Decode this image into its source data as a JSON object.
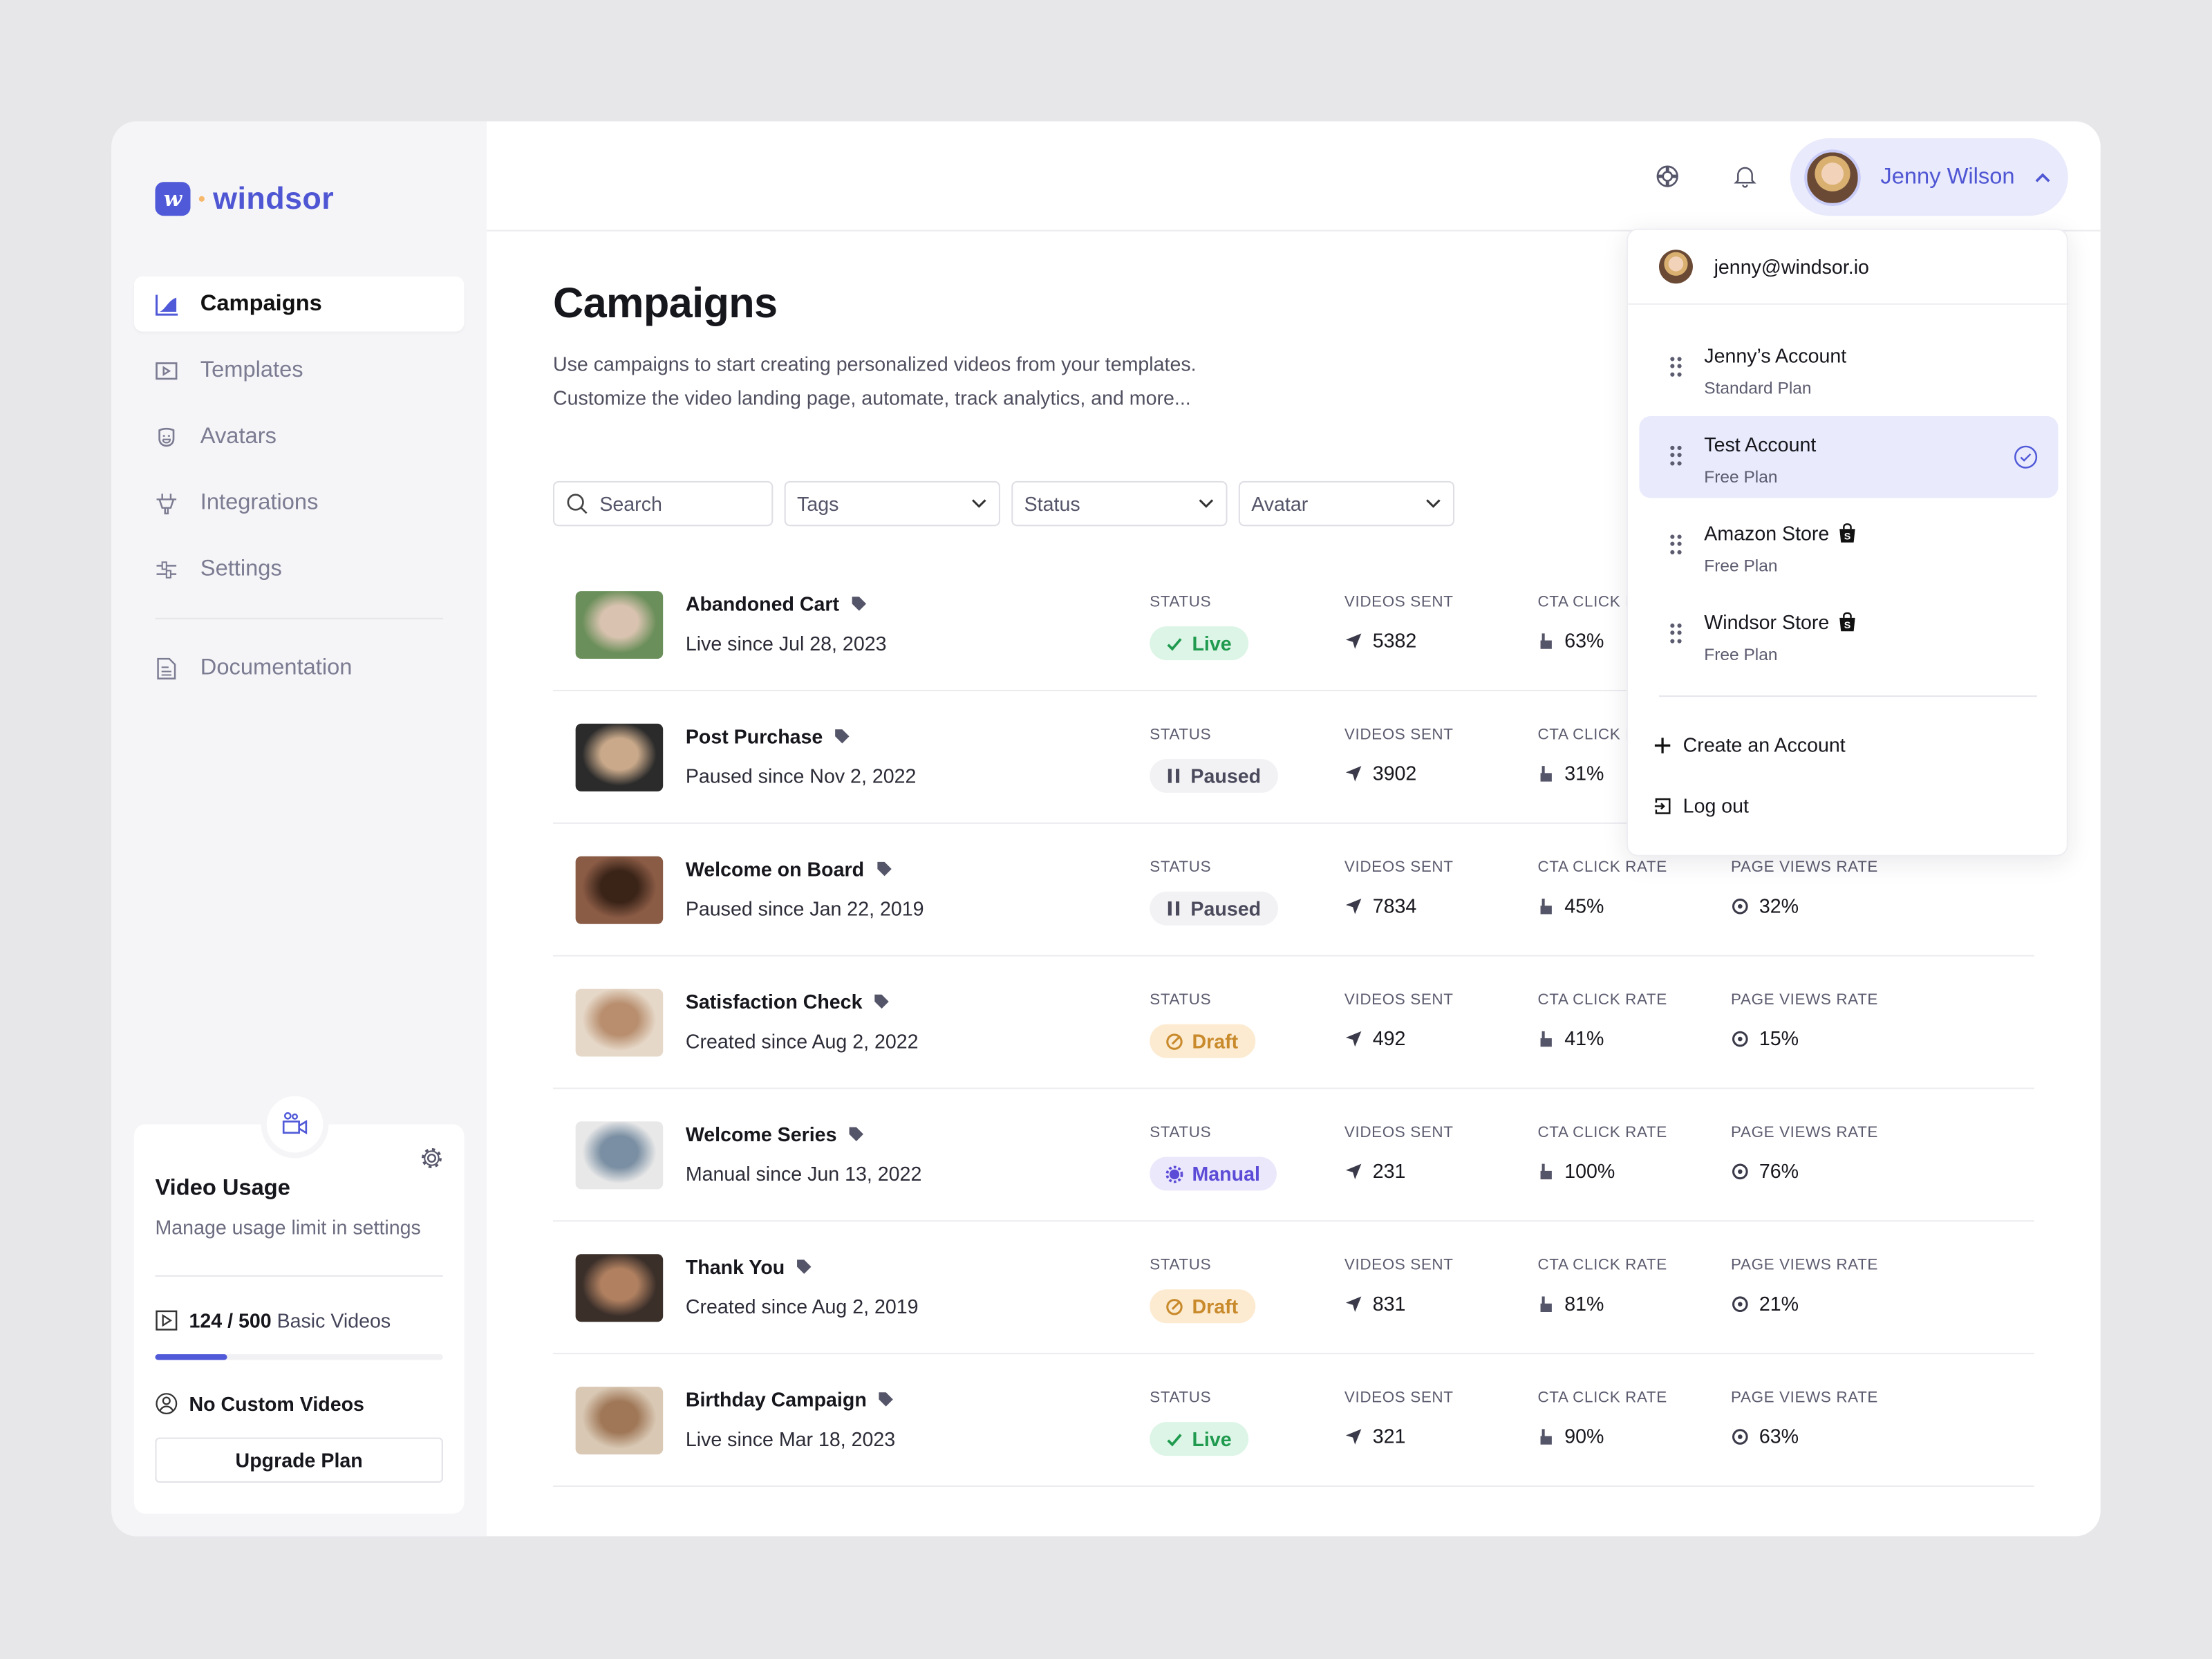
{
  "brand": {
    "name": "windsor",
    "mark": "w",
    "accent": "#5059d8"
  },
  "sidebar": {
    "items": [
      {
        "label": "Campaigns",
        "icon": "chart-area-icon",
        "active": true
      },
      {
        "label": "Templates",
        "icon": "play-box-icon"
      },
      {
        "label": "Avatars",
        "icon": "mask-icon"
      },
      {
        "label": "Integrations",
        "icon": "plug-icon"
      },
      {
        "label": "Settings",
        "icon": "sliders-icon"
      },
      {
        "label": "Documentation",
        "icon": "document-icon"
      }
    ]
  },
  "usage": {
    "title": "Video Usage",
    "subtitle": "Manage usage limit in settings",
    "basic_count": "124 / 500",
    "basic_label": "Basic Videos",
    "basic_fraction": 0.248,
    "custom": "No Custom Videos",
    "upgrade": "Upgrade Plan"
  },
  "header": {
    "user_name": "Jenny Wilson"
  },
  "main": {
    "title": "Campaigns",
    "desc1": "Use campaigns to start creating personalized videos from your templates.",
    "desc2": "Customize the video landing page, automate, track analytics, and more...",
    "filters": {
      "search_placeholder": "Search",
      "tags": "Tags",
      "status": "Status",
      "avatar": "Avatar"
    },
    "labels": {
      "status": "STATUS",
      "videos": "VIDEOS SENT",
      "cta": "CTA CLICK RATE",
      "pv": "PAGE VIEWS RATE"
    }
  },
  "campaigns": [
    {
      "title": "Abandoned Cart",
      "sub": "Live since Jul 28, 2023",
      "status": "Live",
      "videos": "5382",
      "cta": "63%",
      "pv": ""
    },
    {
      "title": "Post Purchase",
      "sub": "Paused since Nov 2, 2022",
      "status": "Paused",
      "videos": "3902",
      "cta": "31%",
      "pv": ""
    },
    {
      "title": "Welcome on Board",
      "sub": "Paused since Jan 22, 2019",
      "status": "Paused",
      "videos": "7834",
      "cta": "45%",
      "pv": "32%"
    },
    {
      "title": "Satisfaction Check",
      "sub": "Created since Aug 2, 2022",
      "status": "Draft",
      "videos": "492",
      "cta": "41%",
      "pv": "15%"
    },
    {
      "title": "Welcome Series",
      "sub": "Manual since Jun 13, 2022",
      "status": "Manual",
      "videos": "231",
      "cta": "100%",
      "pv": "76%"
    },
    {
      "title": "Thank You",
      "sub": "Created since Aug 2, 2019",
      "status": "Draft",
      "videos": "831",
      "cta": "81%",
      "pv": "21%"
    },
    {
      "title": "Birthday Campaign",
      "sub": "Live since Mar 18, 2023",
      "status": "Live",
      "videos": "321",
      "cta": "90%",
      "pv": "63%"
    }
  ],
  "status_colors": {
    "Live": {
      "bg": "#dcf5e6",
      "fg": "#1f9a4e"
    },
    "Paused": {
      "bg": "#f2f2f5",
      "fg": "#4a4a5c"
    },
    "Draft": {
      "bg": "#fcebd1",
      "fg": "#c98a2c"
    },
    "Manual": {
      "bg": "#ebe8fc",
      "fg": "#5b4bd6"
    }
  },
  "dropdown": {
    "email": "jenny@windsor.io",
    "accounts": [
      {
        "name": "Jenny’s Account",
        "plan": "Standard Plan",
        "selected": false,
        "shopify": false
      },
      {
        "name": "Test Account",
        "plan": "Free Plan",
        "selected": true,
        "shopify": false
      },
      {
        "name": "Amazon Store",
        "plan": "Free Plan",
        "selected": false,
        "shopify": true
      },
      {
        "name": "Windsor Store",
        "plan": "Free Plan",
        "selected": false,
        "shopify": true
      }
    ],
    "create": "Create an Account",
    "logout": "Log out"
  }
}
